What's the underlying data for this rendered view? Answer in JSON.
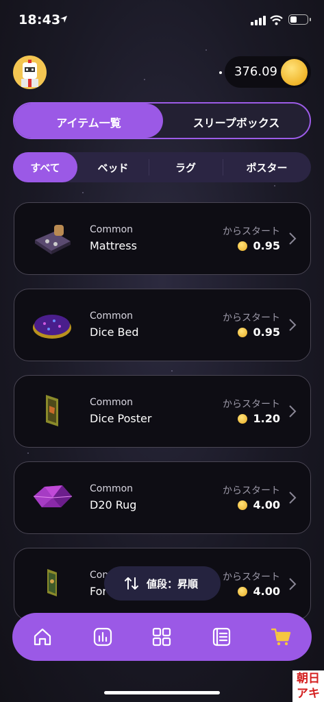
{
  "status_bar": {
    "time": "18:43"
  },
  "header": {
    "coin_balance": "376.09"
  },
  "segments": [
    {
      "label": "アイテム一覧",
      "active": true
    },
    {
      "label": "スリープボックス",
      "active": false
    }
  ],
  "categories": [
    {
      "label": "すべて",
      "active": true
    },
    {
      "label": "ベッド",
      "active": false
    },
    {
      "label": "ラグ",
      "active": false
    },
    {
      "label": "ポスター",
      "active": false
    }
  ],
  "items": [
    {
      "rarity": "Common",
      "name": "Mattress",
      "from_label": "からスタート",
      "price": "0.95",
      "thumb": "mattress-icon"
    },
    {
      "rarity": "Common",
      "name": "Dice Bed",
      "from_label": "からスタート",
      "price": "0.95",
      "thumb": "dice-bed-icon"
    },
    {
      "rarity": "Common",
      "name": "Dice Poster",
      "from_label": "からスタート",
      "price": "1.20",
      "thumb": "dice-poster-icon"
    },
    {
      "rarity": "Common",
      "name": "D20 Rug",
      "from_label": "からスタート",
      "price": "4.00",
      "thumb": "d20-rug-icon"
    },
    {
      "rarity": "Com",
      "name": "For",
      "from_label": "からスタート",
      "price": "4.00",
      "thumb": "poster-icon"
    }
  ],
  "sort": {
    "label": "値段：昇順",
    "icon": "sort-arrows-icon"
  },
  "nav": [
    {
      "icon": "home-icon"
    },
    {
      "icon": "chart-icon"
    },
    {
      "icon": "grid-icon"
    },
    {
      "icon": "list-icon"
    },
    {
      "icon": "cart-icon",
      "active": true
    }
  ],
  "colors": {
    "accent": "#9b59e6",
    "coin": "#f0b52a",
    "card_border": "#4a4654"
  },
  "watermark": {
    "line1": "朝日",
    "line2": "アキ"
  }
}
